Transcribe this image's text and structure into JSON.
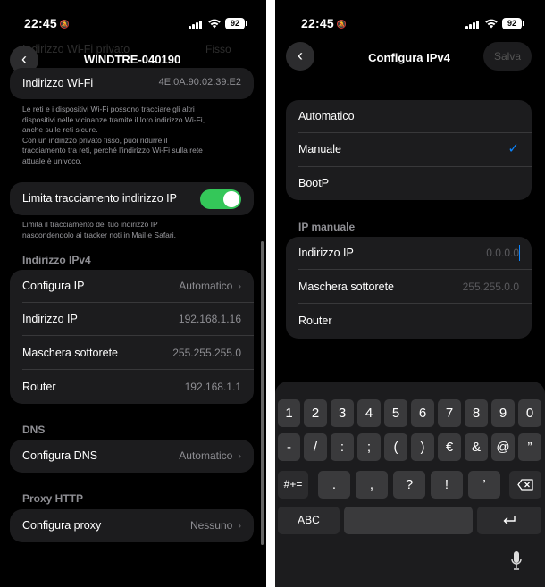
{
  "status": {
    "time": "22:45",
    "battery": "92"
  },
  "left": {
    "title": "WINDTRE-040190",
    "hidden_row": {
      "label": "Indirizzo Wi-Fi privato",
      "value": "Fisso"
    },
    "wifi_address": {
      "label": "Indirizzo Wi-Fi",
      "value": "4E:0A:90:02:39:E2"
    },
    "wifi_note": [
      "Le reti e i dispositivi Wi-Fi possono tracciare gli altri",
      "dispositivi nelle vicinanze tramite il loro indirizzo Wi-Fi,",
      "anche sulle reti sicure.",
      "Con un indirizzo privato fisso, puoi ridurre il",
      "tracciamento tra reti, perché l'indirizzo Wi-Fi sulla rete",
      "attuale è univoco."
    ],
    "limit_tracking": {
      "label": "Limita tracciamento indirizzo IP",
      "enabled": true
    },
    "limit_note": [
      "Limita il tracciamento del tuo indirizzo IP",
      "nascondendolo ai tracker noti in Mail e Safari."
    ],
    "ipv4_header": "Indirizzo IPv4",
    "ipv4_rows": [
      {
        "label": "Configura IP",
        "value": "Automatico",
        "chevron": true
      },
      {
        "label": "Indirizzo IP",
        "value": "192.168.1.16"
      },
      {
        "label": "Maschera sottorete",
        "value": "255.255.255.0"
      },
      {
        "label": "Router",
        "value": "192.168.1.1"
      }
    ],
    "dns_header": "DNS",
    "dns_row": {
      "label": "Configura DNS",
      "value": "Automatico"
    },
    "proxy_header": "Proxy HTTP",
    "proxy_row": {
      "label": "Configura proxy",
      "value": "Nessuno"
    }
  },
  "right": {
    "title": "Configura IPv4",
    "save_label": "Salva",
    "options": [
      {
        "label": "Automatico",
        "selected": false
      },
      {
        "label": "Manuale",
        "selected": true
      },
      {
        "label": "BootP",
        "selected": false
      }
    ],
    "check": "✓",
    "manual_header": "IP manuale",
    "manual_rows": [
      {
        "label": "Indirizzo IP",
        "placeholder": "0.0.0.0"
      },
      {
        "label": "Maschera sottorete",
        "placeholder": "255.255.0.0"
      },
      {
        "label": "Router",
        "placeholder": ""
      }
    ],
    "keyboard": {
      "row1": [
        "1",
        "2",
        "3",
        "4",
        "5",
        "6",
        "7",
        "8",
        "9",
        "0"
      ],
      "row2": [
        "-",
        "/",
        ":",
        ";",
        "(",
        ")",
        "€",
        "&",
        "@",
        "”"
      ],
      "row3": [
        ".",
        ",",
        "?",
        "!",
        "’"
      ],
      "symbols_key": "#+=",
      "abc_key": "ABC",
      "return_icon": "return-icon",
      "delete_icon": "delete-icon",
      "mic_icon": "microphone-icon"
    }
  }
}
